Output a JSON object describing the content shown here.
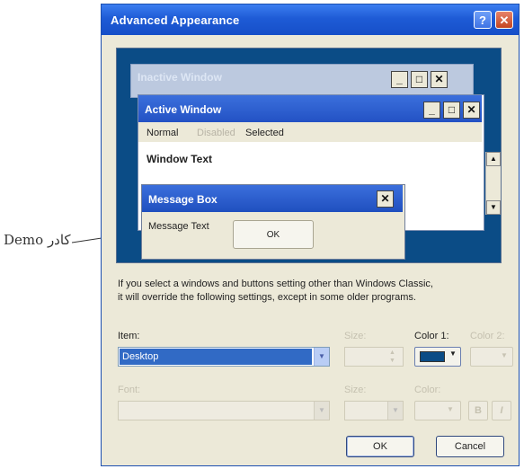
{
  "dialog": {
    "title": "Advanced Appearance",
    "help_glyph": "?",
    "close_glyph": "✕"
  },
  "preview": {
    "inactive_window_title": "Inactive Window",
    "active_window_title": "Active Window",
    "menu": {
      "normal": "Normal",
      "disabled": "Disabled",
      "selected": "Selected"
    },
    "window_text": "Window Text",
    "message_box": {
      "title": "Message Box",
      "text": "Message Text",
      "ok_label": "OK"
    },
    "title_buttons": {
      "minimize": "_",
      "maximize": "□",
      "close": "✕"
    }
  },
  "annotation": {
    "label": "کادر Demo"
  },
  "info": {
    "line1": "If you select a windows and buttons setting other than Windows Classic,",
    "line2": "it will override the following settings, except in some older programs."
  },
  "form": {
    "item_label": "Item:",
    "item_value": "Desktop",
    "size_label": "Size:",
    "color1_label": "Color 1:",
    "color2_label": "Color 2:",
    "font_label": "Font:",
    "size2_label": "Size:",
    "color_label": "Color:",
    "bold_label": "B",
    "italic_label": "I",
    "color1_value": "#0b4c86"
  },
  "buttons": {
    "ok": "OK",
    "cancel": "Cancel"
  },
  "colors": {
    "titlebar": "#1e5bd6",
    "preview_desktop": "#0b4c86",
    "dialog_bg": "#ece9d8",
    "selection": "#316ac5"
  }
}
